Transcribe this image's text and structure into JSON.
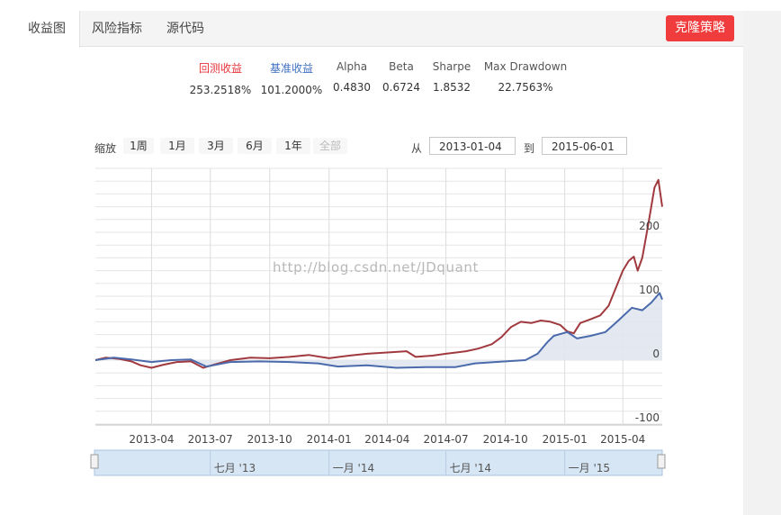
{
  "tabs": [
    {
      "label": "收益图",
      "active": true
    },
    {
      "label": "风险指标",
      "active": false
    },
    {
      "label": "源代码",
      "active": false
    }
  ],
  "clone_button": "克隆策略",
  "metrics": [
    {
      "label": "回测收益",
      "value": "253.2518%",
      "color": "#e8333a"
    },
    {
      "label": "基准收益",
      "value": "101.2000%",
      "color": "#3f6fc2"
    },
    {
      "label": "Alpha",
      "value": "0.4830"
    },
    {
      "label": "Beta",
      "value": "0.6724"
    },
    {
      "label": "Sharpe",
      "value": "1.8532"
    },
    {
      "label": "Max Drawdown",
      "value": "22.7563%"
    }
  ],
  "zoom": {
    "label": "缩放",
    "buttons": [
      "1周",
      "1月",
      "3月",
      "6月",
      "1年",
      "全部"
    ],
    "disabled": "全部"
  },
  "range": {
    "from_label": "从",
    "from": "2013-01-04",
    "to_label": "到",
    "to": "2015-06-01"
  },
  "watermark": "http://blog.csdn.net/JDquant",
  "chart_data": {
    "type": "line",
    "x_range": [
      "2013-01-04",
      "2015-06-01"
    ],
    "ylim": [
      -100,
      300
    ],
    "y_ticks": [
      200,
      100,
      0,
      -100
    ],
    "x_ticks": [
      "2013-04",
      "2013-07",
      "2013-10",
      "2014-01",
      "2014-04",
      "2014-07",
      "2014-10",
      "2015-01",
      "2015-04"
    ],
    "navigator_labels": [
      "七月 '13",
      "一月 '14",
      "七月 '14",
      "一月 '15"
    ],
    "grid": true,
    "series": [
      {
        "name": "回测收益",
        "color": "#a03a3f",
        "points": [
          [
            "2013-01-04",
            0
          ],
          [
            "2013-01-20",
            4
          ],
          [
            "2013-02-10",
            2
          ],
          [
            "2013-03-01",
            -2
          ],
          [
            "2013-03-15",
            -8
          ],
          [
            "2013-04-01",
            -12
          ],
          [
            "2013-04-20",
            -7
          ],
          [
            "2013-05-10",
            -3
          ],
          [
            "2013-06-01",
            -2
          ],
          [
            "2013-06-20",
            -12
          ],
          [
            "2013-07-10",
            -6
          ],
          [
            "2013-08-01",
            0
          ],
          [
            "2013-09-01",
            4
          ],
          [
            "2013-10-01",
            3
          ],
          [
            "2013-11-01",
            5
          ],
          [
            "2013-12-01",
            8
          ],
          [
            "2014-01-01",
            3
          ],
          [
            "2014-02-01",
            7
          ],
          [
            "2014-03-01",
            10
          ],
          [
            "2014-04-01",
            12
          ],
          [
            "2014-05-01",
            14
          ],
          [
            "2014-05-15",
            5
          ],
          [
            "2014-06-10",
            7
          ],
          [
            "2014-07-01",
            10
          ],
          [
            "2014-08-01",
            14
          ],
          [
            "2014-08-20",
            18
          ],
          [
            "2014-09-10",
            25
          ],
          [
            "2014-09-25",
            36
          ],
          [
            "2014-10-10",
            52
          ],
          [
            "2014-10-25",
            60
          ],
          [
            "2014-11-10",
            58
          ],
          [
            "2014-11-25",
            62
          ],
          [
            "2014-12-10",
            60
          ],
          [
            "2014-12-25",
            55
          ],
          [
            "2015-01-05",
            45
          ],
          [
            "2015-01-15",
            42
          ],
          [
            "2015-01-25",
            58
          ],
          [
            "2015-02-10",
            64
          ],
          [
            "2015-02-25",
            70
          ],
          [
            "2015-03-10",
            85
          ],
          [
            "2015-03-20",
            110
          ],
          [
            "2015-04-01",
            140
          ],
          [
            "2015-04-10",
            155
          ],
          [
            "2015-04-18",
            162
          ],
          [
            "2015-04-24",
            140
          ],
          [
            "2015-05-01",
            160
          ],
          [
            "2015-05-10",
            210
          ],
          [
            "2015-05-20",
            270
          ],
          [
            "2015-05-26",
            282
          ],
          [
            "2015-06-01",
            240
          ]
        ]
      },
      {
        "name": "基准收益",
        "color": "#4a6aab",
        "points": [
          [
            "2013-01-04",
            0
          ],
          [
            "2013-02-01",
            4
          ],
          [
            "2013-03-01",
            1
          ],
          [
            "2013-04-01",
            -3
          ],
          [
            "2013-05-01",
            0
          ],
          [
            "2013-06-01",
            1
          ],
          [
            "2013-06-25",
            -10
          ],
          [
            "2013-08-01",
            -3
          ],
          [
            "2013-09-15",
            -2
          ],
          [
            "2013-11-01",
            -3
          ],
          [
            "2013-12-15",
            -5
          ],
          [
            "2014-01-15",
            -10
          ],
          [
            "2014-03-01",
            -8
          ],
          [
            "2014-04-15",
            -12
          ],
          [
            "2014-06-01",
            -11
          ],
          [
            "2014-07-15",
            -11
          ],
          [
            "2014-08-15",
            -5
          ],
          [
            "2014-09-15",
            -3
          ],
          [
            "2014-10-15",
            -1
          ],
          [
            "2014-11-01",
            0
          ],
          [
            "2014-11-20",
            10
          ],
          [
            "2014-12-05",
            28
          ],
          [
            "2014-12-15",
            38
          ],
          [
            "2015-01-05",
            44
          ],
          [
            "2015-01-20",
            34
          ],
          [
            "2015-02-10",
            38
          ],
          [
            "2015-03-05",
            44
          ],
          [
            "2015-03-25",
            62
          ],
          [
            "2015-04-15",
            82
          ],
          [
            "2015-05-01",
            78
          ],
          [
            "2015-05-15",
            90
          ],
          [
            "2015-05-28",
            105
          ],
          [
            "2015-06-01",
            95
          ]
        ]
      }
    ]
  }
}
